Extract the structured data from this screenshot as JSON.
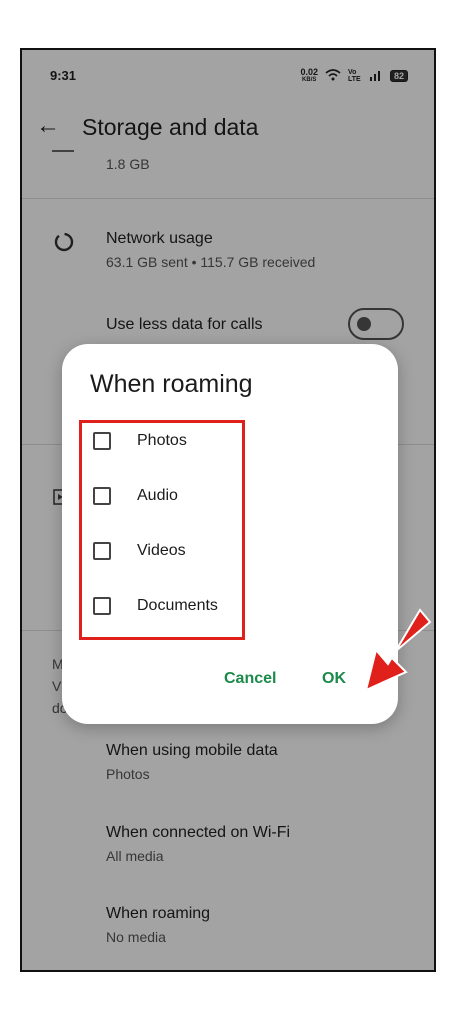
{
  "status_bar": {
    "time": "9:31",
    "net_speed": "0.02",
    "net_speed_unit": "KB/S",
    "network_label": "Vo LTE",
    "battery": "82"
  },
  "app_bar": {
    "title": "Storage and data"
  },
  "settings": {
    "storage_sub": "1.8 GB",
    "network_usage_title": "Network usage",
    "network_usage_sub": "63.1 GB sent • 115.7 GB received",
    "less_data_title": "Use less data for calls",
    "less_data_enabled": false,
    "partial_left_text": [
      "M",
      "V",
      "do"
    ],
    "mobile_data_title": "When using mobile data",
    "mobile_data_sub": "Photos",
    "wifi_title": "When connected on Wi-Fi",
    "wifi_sub": "All media",
    "roaming_title": "When roaming",
    "roaming_sub": "No media"
  },
  "dialog": {
    "title": "When roaming",
    "options": [
      {
        "label": "Photos",
        "checked": false
      },
      {
        "label": "Audio",
        "checked": false
      },
      {
        "label": "Videos",
        "checked": false
      },
      {
        "label": "Documents",
        "checked": false
      }
    ],
    "cancel_label": "Cancel",
    "ok_label": "OK"
  },
  "colors": {
    "accent": "#1c8a4b",
    "highlight": "#e0201b",
    "overlay": "rgba(0,0,0,0.36)"
  }
}
